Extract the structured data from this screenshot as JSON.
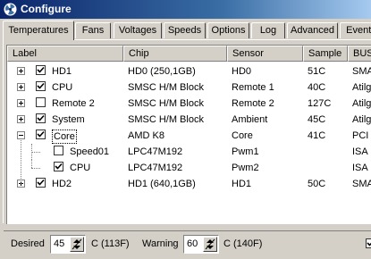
{
  "window": {
    "title": "Configure"
  },
  "tabs": [
    "Temperatures",
    "Fans",
    "Voltages",
    "Speeds",
    "Options",
    "Log",
    "Advanced",
    "Events"
  ],
  "columns": [
    "Label",
    "Chip",
    "Sensor",
    "Sample",
    "BUS"
  ],
  "rows": [
    {
      "label": "HD1",
      "chip": "HD0 (250,1GB)",
      "sensor": "HD0",
      "sample": "51C",
      "bus": "SMART",
      "checked": true,
      "expandable": true,
      "level": 0
    },
    {
      "label": "CPU",
      "chip": "SMSC H/M Block",
      "sensor": "Remote 1",
      "sample": "40C",
      "bus": "Atilgan",
      "checked": true,
      "expandable": true,
      "level": 0
    },
    {
      "label": "Remote 2",
      "chip": "SMSC H/M Block",
      "sensor": "Remote 2",
      "sample": "127C",
      "bus": "Atilgan",
      "checked": false,
      "expandable": true,
      "level": 0
    },
    {
      "label": "System",
      "chip": "SMSC H/M Block",
      "sensor": "Ambient",
      "sample": "45C",
      "bus": "Atilgan",
      "checked": true,
      "expandable": true,
      "level": 0
    },
    {
      "label": "Core",
      "chip": "AMD K8",
      "sensor": "Core",
      "sample": "41C",
      "bus": "PCI",
      "checked": true,
      "expandable": true,
      "expanded": true,
      "selected": true,
      "level": 0
    },
    {
      "label": "Speed01",
      "chip": "LPC47M192",
      "sensor": "Pwm1",
      "sample": "",
      "bus": "ISA",
      "checked": false,
      "expandable": false,
      "level": 1
    },
    {
      "label": "CPU",
      "chip": "LPC47M192",
      "sensor": "Pwm2",
      "sample": "",
      "bus": "ISA",
      "checked": true,
      "expandable": false,
      "level": 1
    },
    {
      "label": "HD2",
      "chip": "HD1 (640,1GB)",
      "sensor": "HD1",
      "sample": "50C",
      "bus": "SMART",
      "checked": true,
      "expandable": true,
      "level": 0
    }
  ],
  "bottom": {
    "desired_label": "Desired",
    "desired_value": "45",
    "desired_unit": "C (113F)",
    "warning_label": "Warning",
    "warning_value": "60",
    "warning_unit": "C (140F)"
  }
}
